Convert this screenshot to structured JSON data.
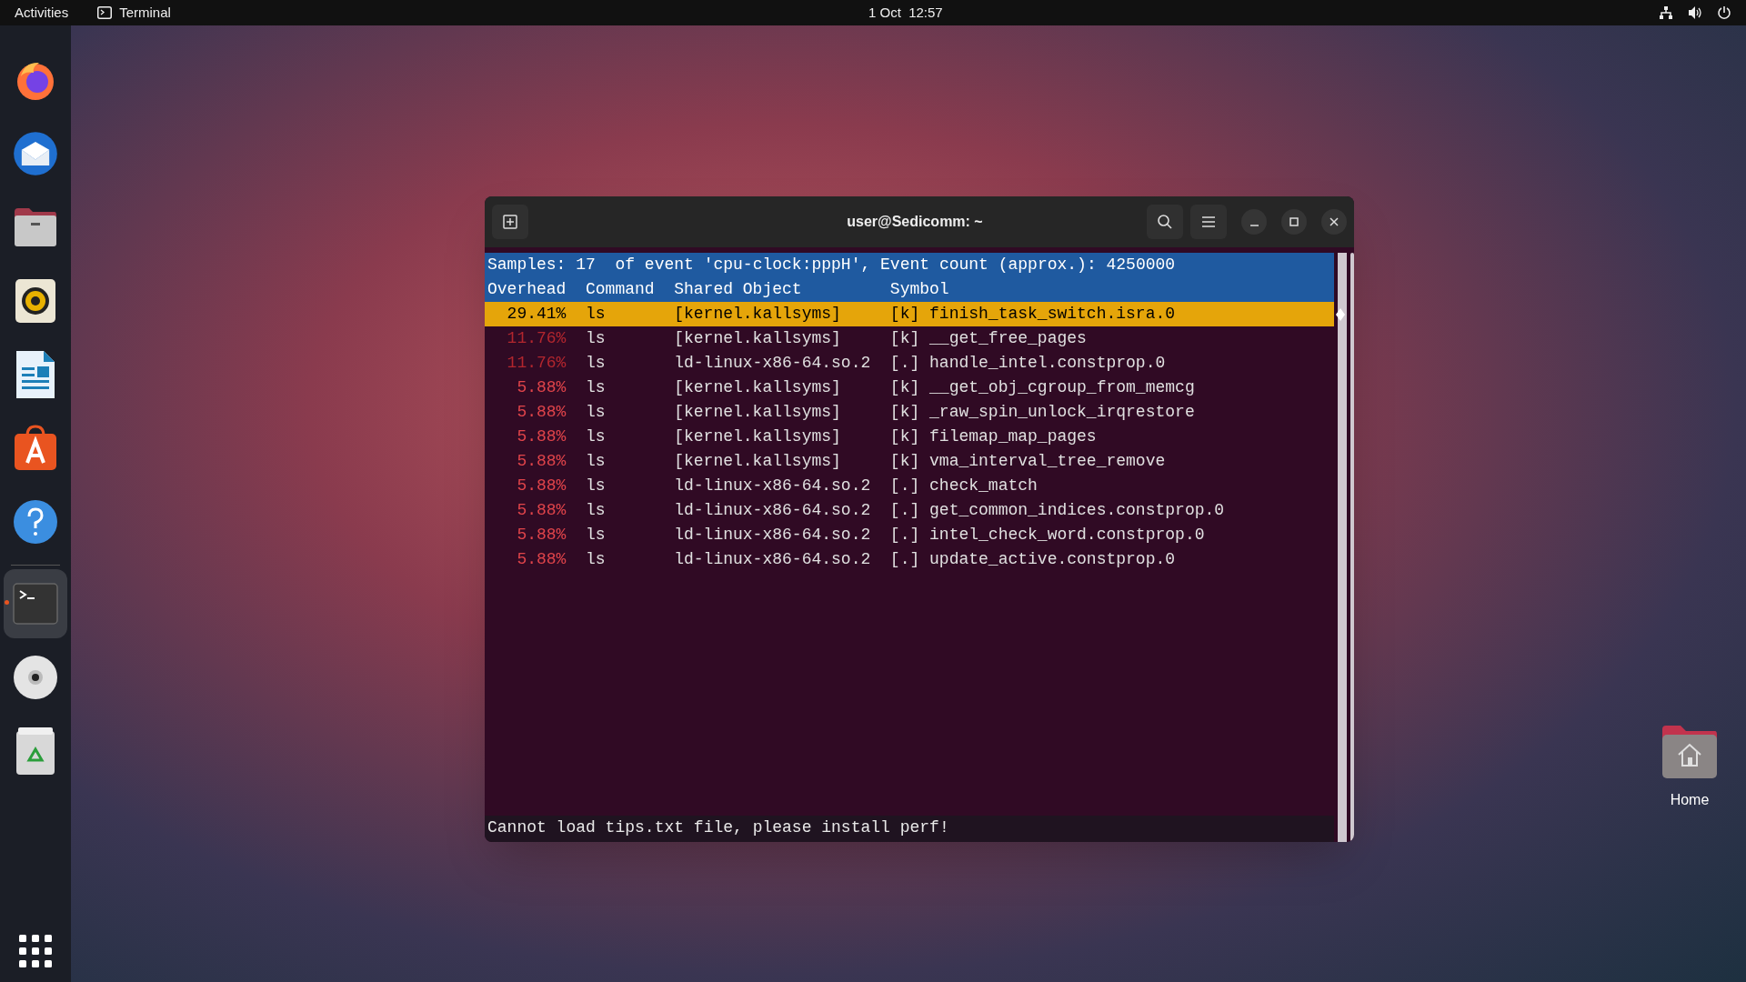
{
  "top_bar": {
    "activities": "Activities",
    "app": "Terminal",
    "clock": "1 Oct  12:57"
  },
  "dock": {
    "items": [
      {
        "kind": "firefox",
        "running": false
      },
      {
        "kind": "mail",
        "running": false
      },
      {
        "kind": "files",
        "running": false
      },
      {
        "kind": "speaker",
        "running": false
      },
      {
        "kind": "writer",
        "running": false
      },
      {
        "kind": "store",
        "running": false
      },
      {
        "kind": "help",
        "running": false
      },
      {
        "kind": "terminal",
        "running": true
      },
      {
        "kind": "disc",
        "running": false
      },
      {
        "kind": "trash",
        "running": false
      }
    ]
  },
  "terminal": {
    "title": "user@Sedicomm: ~",
    "summary": "Samples: 17  of event 'cpu-clock:pppH', Event count (approx.): 4250000",
    "columns": [
      "Overhead",
      "Command",
      "Shared Object",
      "Symbol"
    ],
    "rows": [
      {
        "overhead": "29.41%",
        "command": "ls",
        "shared_object": "[kernel.kallsyms]",
        "symbol": "[k] finish_task_switch.isra.0",
        "selected": true
      },
      {
        "overhead": "11.76%",
        "command": "ls",
        "shared_object": "[kernel.kallsyms]",
        "symbol": "[k] __get_free_pages",
        "selected": false,
        "color": "#b3262e"
      },
      {
        "overhead": "11.76%",
        "command": "ls",
        "shared_object": "ld-linux-x86-64.so.2",
        "symbol": "[.] handle_intel.constprop.0",
        "selected": false,
        "color": "#b3262e"
      },
      {
        "overhead": "5.88%",
        "command": "ls",
        "shared_object": "[kernel.kallsyms]",
        "symbol": "[k] __get_obj_cgroup_from_memcg",
        "selected": false,
        "color": "#e0444a"
      },
      {
        "overhead": "5.88%",
        "command": "ls",
        "shared_object": "[kernel.kallsyms]",
        "symbol": "[k] _raw_spin_unlock_irqrestore",
        "selected": false,
        "color": "#e0444a"
      },
      {
        "overhead": "5.88%",
        "command": "ls",
        "shared_object": "[kernel.kallsyms]",
        "symbol": "[k] filemap_map_pages",
        "selected": false,
        "color": "#e0444a"
      },
      {
        "overhead": "5.88%",
        "command": "ls",
        "shared_object": "[kernel.kallsyms]",
        "symbol": "[k] vma_interval_tree_remove",
        "selected": false,
        "color": "#e0444a"
      },
      {
        "overhead": "5.88%",
        "command": "ls",
        "shared_object": "ld-linux-x86-64.so.2",
        "symbol": "[.] check_match",
        "selected": false,
        "color": "#e0444a"
      },
      {
        "overhead": "5.88%",
        "command": "ls",
        "shared_object": "ld-linux-x86-64.so.2",
        "symbol": "[.] get_common_indices.constprop.0",
        "selected": false,
        "color": "#e0444a"
      },
      {
        "overhead": "5.88%",
        "command": "ls",
        "shared_object": "ld-linux-x86-64.so.2",
        "symbol": "[.] intel_check_word.constprop.0",
        "selected": false,
        "color": "#e0444a"
      },
      {
        "overhead": "5.88%",
        "command": "ls",
        "shared_object": "ld-linux-x86-64.so.2",
        "symbol": "[.] update_active.constprop.0",
        "selected": false,
        "color": "#e0444a"
      }
    ],
    "status": "Cannot load tips.txt file, please install perf!"
  },
  "desktop_icons": [
    {
      "label": "Home"
    }
  ]
}
